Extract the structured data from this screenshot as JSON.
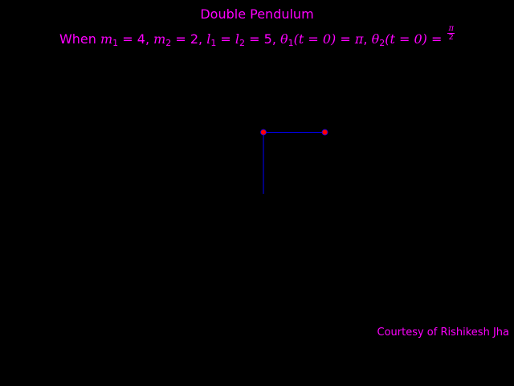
{
  "title": "Double Pendulum",
  "parameters": {
    "prefix": "When",
    "m1_symbol": "m",
    "m1_subscript": "1",
    "m1_value": "4",
    "m2_symbol": "m",
    "m2_subscript": "2",
    "m2_value": "2",
    "l1_symbol": "l",
    "l1_subscript": "1",
    "l2_symbol": "l",
    "l2_subscript": "2",
    "l_value": "5",
    "theta1_symbol": "θ",
    "theta1_subscript": "1",
    "theta1_arg": "(t = 0)",
    "theta1_value": "π",
    "theta2_symbol": "θ",
    "theta2_subscript": "2",
    "theta2_arg": "(t = 0)",
    "theta2_num": "π",
    "theta2_den": "2"
  },
  "credit": "Courtesy of Rishikesh Jha",
  "colors": {
    "background": "#000000",
    "text": "#ff00ff",
    "rod": "#0000ff",
    "bob": "#ff0000"
  },
  "pendulum": {
    "l1": 5,
    "l2": 5,
    "theta1": 3.14159265,
    "theta2": 1.57079633
  }
}
